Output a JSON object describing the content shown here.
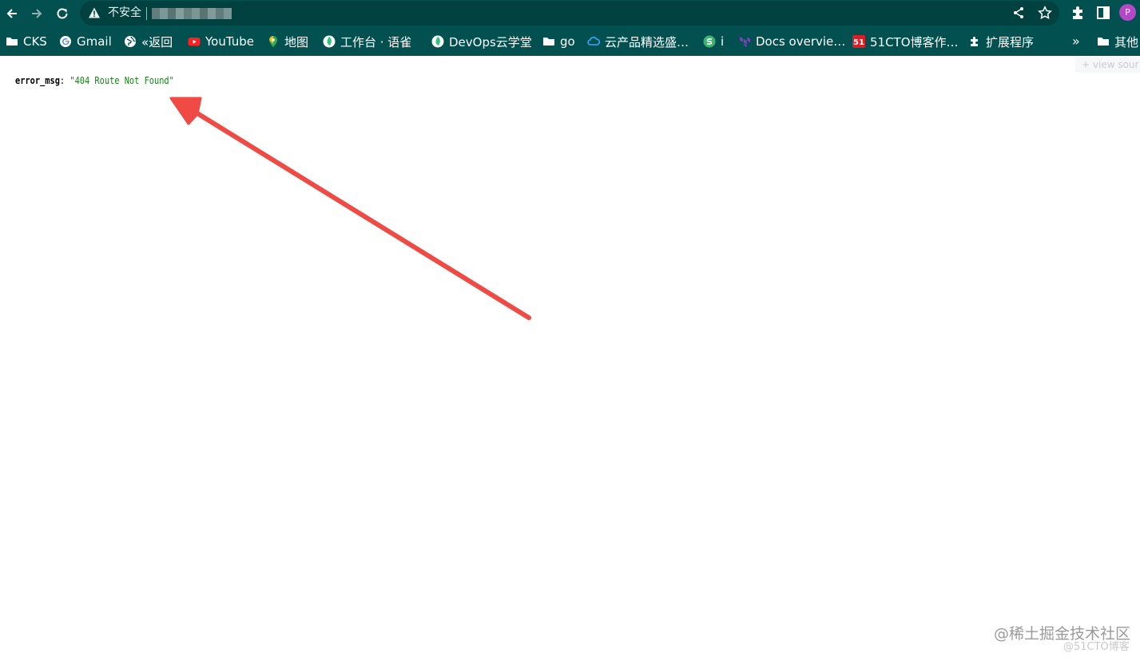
{
  "browser": {
    "omnibox": {
      "security_label": "不安全"
    },
    "profile_initial": "P",
    "bookmarks": [
      {
        "label": "CKS",
        "icon": "folder-icon"
      },
      {
        "label": "Gmail",
        "icon": "google-icon"
      },
      {
        "label": "«返回",
        "icon": "globe-icon"
      },
      {
        "label": "YouTube",
        "icon": "youtube-icon"
      },
      {
        "label": "地图",
        "icon": "maps-pin-icon"
      },
      {
        "label": "工作台 · 语雀",
        "icon": "yuque-icon"
      },
      {
        "label": "DevOps云学堂",
        "icon": "yuque-icon"
      },
      {
        "label": "go",
        "icon": "folder-icon"
      },
      {
        "label": "云产品精选盛…",
        "icon": "cloud-icon"
      },
      {
        "label": "i",
        "icon": "s-logo-icon"
      },
      {
        "label": "Docs overvie…",
        "icon": "terraform-icon"
      },
      {
        "label": "51CTO博客作…",
        "icon": "51cto-icon"
      },
      {
        "label": "扩展程序",
        "icon": "puzzle-icon"
      }
    ],
    "bookmarks_overflow": "»",
    "other_bookmarks": "其他"
  },
  "page": {
    "view_source_label": "+ view sour",
    "json_key": "error_msg",
    "json_colon": ":",
    "json_value": "\"404 Route Not Found\""
  },
  "watermarks": {
    "line1": "@稀土掘金技术社区",
    "line2": "@51CTO博客"
  },
  "colors": {
    "toolbar_bg": "#02504f",
    "omnibox_bg": "#014140",
    "json_string": "#1a7f1a",
    "arrow": "#ef4a43",
    "avatar": "#b548c6"
  }
}
